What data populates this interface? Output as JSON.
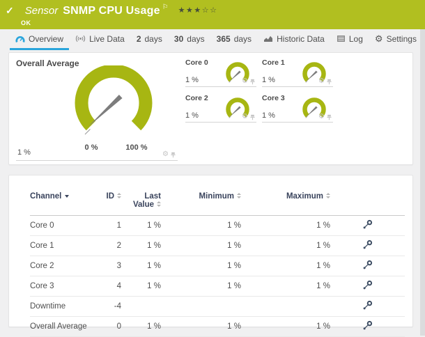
{
  "colors": {
    "status_green": "#b1bf20",
    "gauge_green": "#a7b612",
    "accent_blue": "#2aa5dc",
    "header_navy": "#39435c"
  },
  "header": {
    "check_icon": "✓",
    "type_label": "Sensor",
    "title": "SNMP CPU Usage",
    "flag_icon": "⚐",
    "rating": {
      "filled": 3,
      "total": 5
    },
    "status_text": "OK"
  },
  "tabs": [
    {
      "id": "overview",
      "icon": "gauge",
      "strong": "",
      "label": "Overview",
      "active": true
    },
    {
      "id": "live-data",
      "icon": "broadcast",
      "strong": "",
      "label": "Live Data",
      "active": false
    },
    {
      "id": "2-days",
      "icon": "",
      "strong": "2",
      "label": "days",
      "active": false
    },
    {
      "id": "30-days",
      "icon": "",
      "strong": "30",
      "label": "days",
      "active": false
    },
    {
      "id": "365-days",
      "icon": "",
      "strong": "365",
      "label": "days",
      "active": false
    },
    {
      "id": "historic-data",
      "icon": "chart",
      "strong": "",
      "label": "Historic Data",
      "active": false
    },
    {
      "id": "log",
      "icon": "log",
      "strong": "",
      "label": "Log",
      "active": false
    },
    {
      "id": "settings",
      "icon": "gear",
      "strong": "",
      "label": "Settings",
      "active": false
    }
  ],
  "gauges": {
    "overall": {
      "title": "Overall Average",
      "value": "1 %",
      "min_label": "0 %",
      "max_label": "100 %"
    },
    "cores": [
      {
        "title": "Core 0",
        "value": "1 %"
      },
      {
        "title": "Core 1",
        "value": "1 %"
      },
      {
        "title": "Core 2",
        "value": "1 %"
      },
      {
        "title": "Core 3",
        "value": "1 %"
      }
    ]
  },
  "table": {
    "headers": {
      "channel": "Channel",
      "id": "ID",
      "last_line1": "Last",
      "last_line2": "Value",
      "minimum": "Minimum",
      "maximum": "Maximum"
    },
    "rows": [
      {
        "channel": "Core 0",
        "id": "1",
        "last": "1 %",
        "min": "1 %",
        "max": "1 %"
      },
      {
        "channel": "Core 1",
        "id": "2",
        "last": "1 %",
        "min": "1 %",
        "max": "1 %"
      },
      {
        "channel": "Core 2",
        "id": "3",
        "last": "1 %",
        "min": "1 %",
        "max": "1 %"
      },
      {
        "channel": "Core 3",
        "id": "4",
        "last": "1 %",
        "min": "1 %",
        "max": "1 %"
      },
      {
        "channel": "Downtime",
        "id": "-4",
        "last": "",
        "min": "",
        "max": ""
      },
      {
        "channel": "Overall Average",
        "id": "0",
        "last": "1 %",
        "min": "1 %",
        "max": "1 %"
      }
    ]
  }
}
